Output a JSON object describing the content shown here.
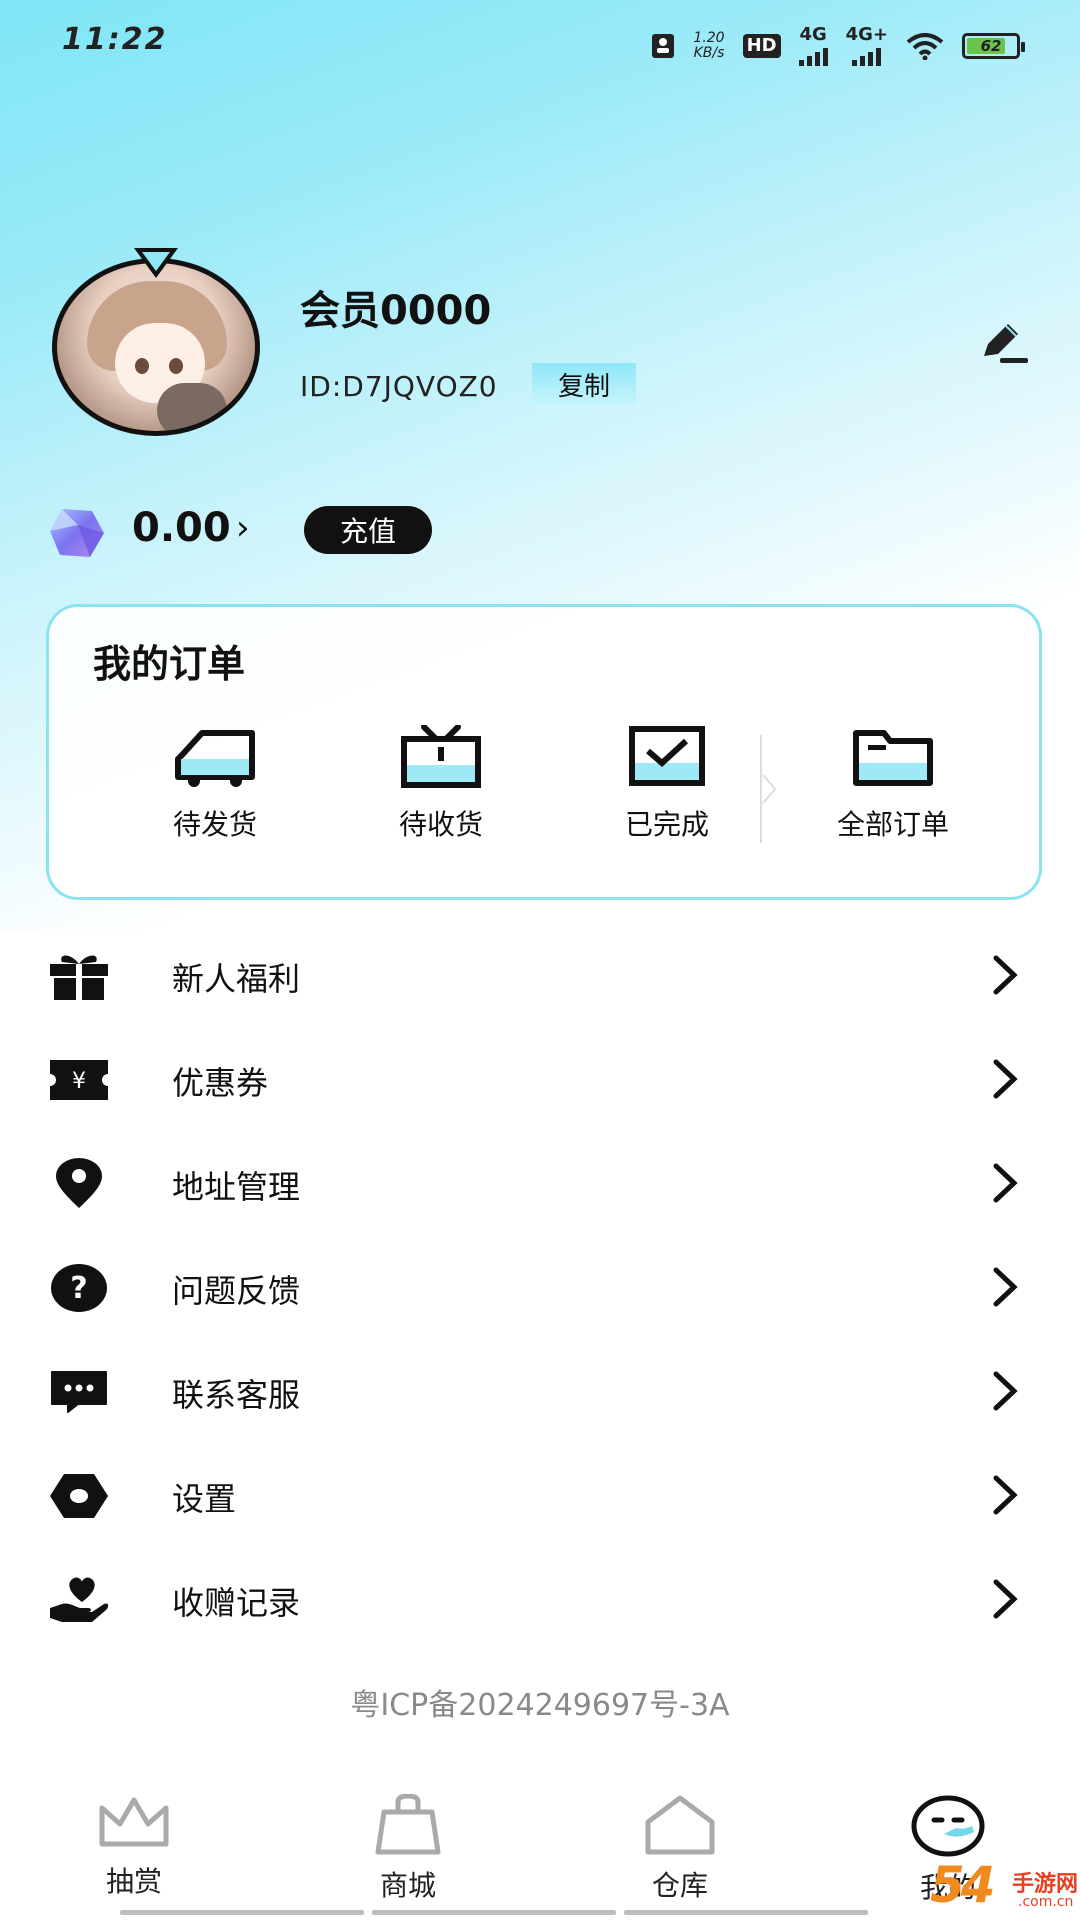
{
  "status_bar": {
    "time": "11:22",
    "net_speed_value": "1.20",
    "net_speed_unit": "KB/s",
    "hd_label": "HD",
    "sim1_label": "4G",
    "sim2_label": "4G+",
    "battery_level": "62"
  },
  "profile": {
    "username": "会员0000",
    "user_id": "ID:D7JQVOZ0",
    "copy_label": "复制",
    "balance": "0.00",
    "balance_arrow": "›",
    "recharge_label": "充值"
  },
  "orders": {
    "title": "我的订单",
    "items": [
      {
        "label": "待发货",
        "icon": "truck-icon"
      },
      {
        "label": "待收货",
        "icon": "tv-box-icon"
      },
      {
        "label": "已完成",
        "icon": "checkmark-box-icon"
      },
      {
        "label": "全部订单",
        "icon": "folder-icon"
      }
    ]
  },
  "menu": {
    "items": [
      {
        "label": "新人福利",
        "icon": "gift-icon"
      },
      {
        "label": "优惠券",
        "icon": "coupon-icon"
      },
      {
        "label": "地址管理",
        "icon": "location-pin-icon"
      },
      {
        "label": "问题反馈",
        "icon": "question-icon"
      },
      {
        "label": "联系客服",
        "icon": "chat-bubble-icon"
      },
      {
        "label": "设置",
        "icon": "settings-hexagon-icon"
      },
      {
        "label": "收赠记录",
        "icon": "heart-hand-icon"
      }
    ]
  },
  "icp": "粤ICP备2024249697号-3A",
  "tab_bar": {
    "tabs": [
      {
        "label": "抽赏",
        "icon": "crown-icon"
      },
      {
        "label": "商城",
        "icon": "shopping-bag-icon"
      },
      {
        "label": "仓库",
        "icon": "house-icon"
      },
      {
        "label": "我的",
        "icon": "smiley-face-icon",
        "active": true
      }
    ]
  },
  "watermark": {
    "main": "54",
    "site_name": "手游网",
    "site_domain": ".com.cn"
  }
}
